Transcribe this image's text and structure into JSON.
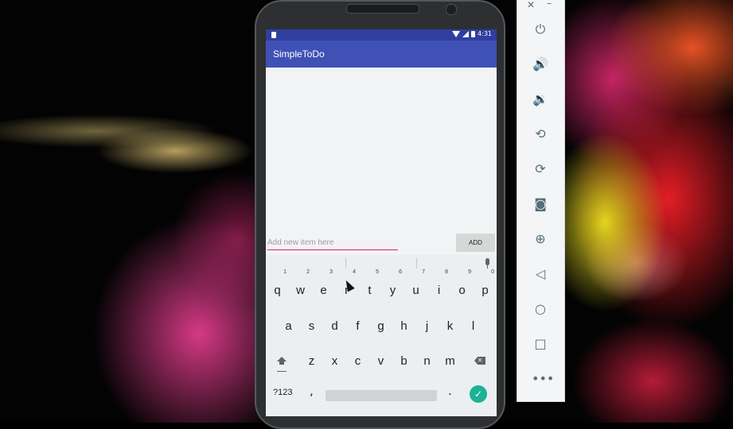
{
  "app": {
    "title": "SimpleToDo",
    "status_time": "4:31"
  },
  "form": {
    "input_placeholder": "Add new item here",
    "add_label": "ADD"
  },
  "keyboard": {
    "row1": [
      {
        "key": "q",
        "hint": "1"
      },
      {
        "key": "w",
        "hint": "2"
      },
      {
        "key": "e",
        "hint": "3"
      },
      {
        "key": "r",
        "hint": "4"
      },
      {
        "key": "t",
        "hint": "5"
      },
      {
        "key": "y",
        "hint": "6"
      },
      {
        "key": "u",
        "hint": "7"
      },
      {
        "key": "i",
        "hint": "8"
      },
      {
        "key": "o",
        "hint": "9"
      },
      {
        "key": "p",
        "hint": "0"
      }
    ],
    "row2": [
      "a",
      "s",
      "d",
      "f",
      "g",
      "h",
      "j",
      "k",
      "l"
    ],
    "row3": [
      "z",
      "x",
      "c",
      "v",
      "b",
      "n",
      "m"
    ],
    "symbols_label": "?123",
    "comma": ",",
    "period": "."
  },
  "emulator_panel": {
    "window_controls": [
      "close-icon",
      "minimize-icon"
    ],
    "buttons": [
      "power-icon",
      "volume-up-icon",
      "volume-down-icon",
      "rotate-left-icon",
      "rotate-right-icon",
      "camera-icon",
      "zoom-icon",
      "back-icon",
      "home-icon",
      "overview-icon",
      "more-icon"
    ]
  },
  "colors": {
    "status_bar": "#303f9f",
    "toolbar": "#3f51b5",
    "input_underline": "#e91e63",
    "enter_key": "#1ab394"
  }
}
